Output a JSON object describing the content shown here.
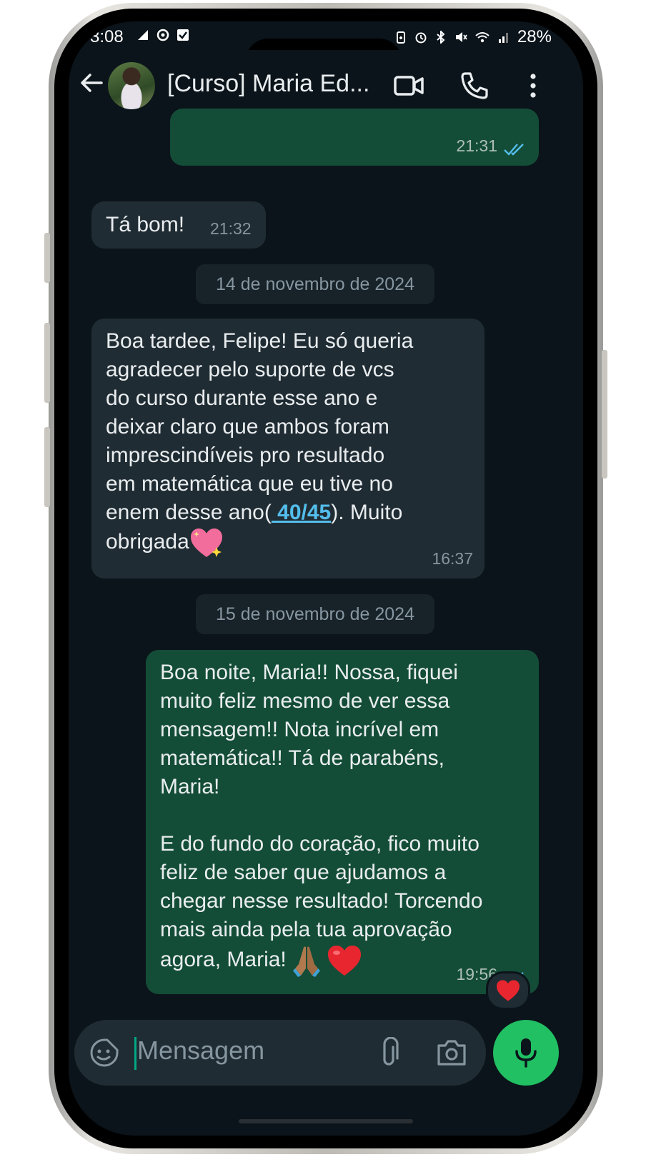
{
  "status_bar": {
    "time": "3:08",
    "battery": "28%"
  },
  "header": {
    "contact_name": "[Curso] Maria Ed..."
  },
  "messages": [
    {
      "id": "m0",
      "time": "21:31"
    },
    {
      "id": "m1",
      "text": "Tá bom!",
      "time": "21:32"
    },
    {
      "id": "d1",
      "date": "14 de novembro de 2024"
    },
    {
      "id": "m2",
      "text_before": "Boa tardee, Felipe! Eu só queria\nagradecer pelo suporte de vcs\ndo curso durante esse ano e\ndeixar claro que ambos foram\nimprescindíveis pro resultado\nem matemática que eu tive no\nenem desse ano(",
      "link": " 40/45",
      "text_after": "). Muito\nobrigada",
      "emoji": "sparkling-heart",
      "time": "16:37"
    },
    {
      "id": "d2",
      "date": "15 de novembro de 2024"
    },
    {
      "id": "m3",
      "text": "Boa noite, Maria!! Nossa, fiquei\nmuito feliz mesmo de ver essa\nmensagem!! Nota incrível em\nmatemática!! Tá de parabéns,\nMaria!\n\nE do fundo do coração, fico muito\nfeliz de saber que ajudamos a\nchegar nesse resultado! Torcendo\nmais ainda pela tua aprovação\nagora, Maria!",
      "emojis": [
        "folded-hands",
        "red-heart"
      ],
      "time": "19:56",
      "reaction": "red-heart"
    }
  ],
  "composer": {
    "placeholder": "Mensagem"
  },
  "colors": {
    "background": "#0b141a",
    "incoming_bubble": "#202c33",
    "outgoing_bubble": "#144d37",
    "accent": "#21c063",
    "link": "#53bdeb",
    "read_ticks": "#53bdeb"
  }
}
